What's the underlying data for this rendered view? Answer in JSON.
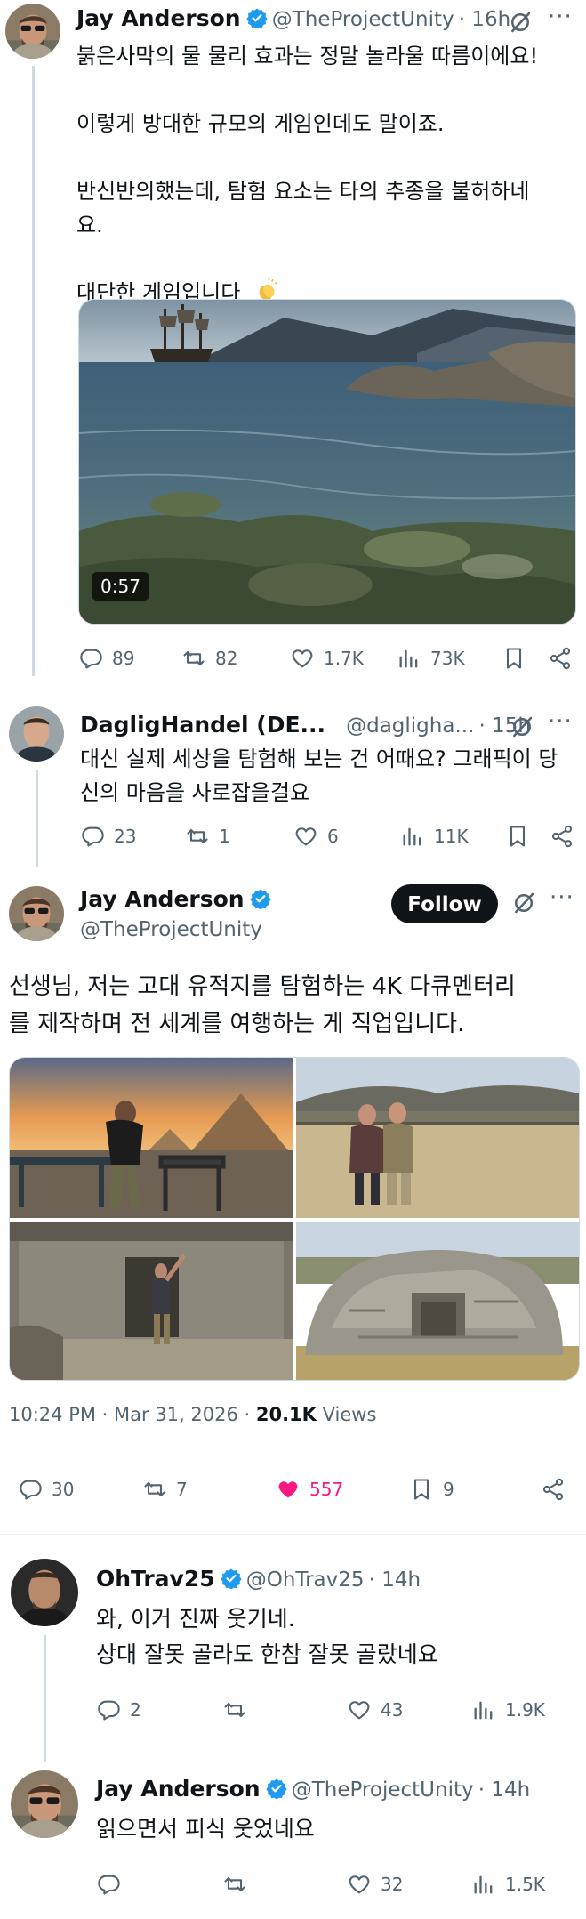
{
  "tweet1": {
    "name": "Jay Anderson",
    "handle": "@TheProjectUnity",
    "time": "· 16h",
    "lines": [
      "붉은사막의 물 물리 효과는 정말 놀라울 따름이에요!",
      "이렇게 방대한 규모의 게임인데도 말이죠.",
      "반신반의했는데, 탐험 요소는 타의 추종을 불허하네",
      "요.",
      "대단한 게임입니다"
    ],
    "emoji": "clapping-hands",
    "video_duration": "0:57",
    "replies": "89",
    "reposts": "82",
    "likes": "1.7K",
    "views": "73K"
  },
  "tweet2": {
    "name": "DagligHandel (DE...",
    "handle": "@daglighа...",
    "time": "· 15h",
    "lines": [
      "대신 실제 세상을 탐험해 보는 건 어때요? 그래픽이 당",
      "신의 마음을 사로잡을걸요"
    ],
    "replies": "23",
    "reposts": "1",
    "likes": "6",
    "views": "11K"
  },
  "main_tweet": {
    "name": "Jay Anderson",
    "handle": "@TheProjectUnity",
    "follow_label": "Follow",
    "lines": [
      "선생님, 저는 고대 유적지를 탐험하는 4K 다큐멘터리",
      "를 제작하며 전 세계를 여행하는 게 직업입니다."
    ],
    "timestamp": "10:24 PM · Mar 31, 2026 · ",
    "views_count": "20.1K",
    "views_label": " Views",
    "replies": "30",
    "reposts": "7",
    "likes": "557",
    "bookmarks": "9",
    "like_color": "#f91880"
  },
  "reply1": {
    "name": "OhTrav25",
    "handle": "@OhTrav25",
    "time": "· 14h",
    "lines": [
      "와, 이거 진짜 웃기네.",
      "상대 잘못 골라도 한참 잘못 골랐네요"
    ],
    "replies": "2",
    "likes": "43",
    "views": "1.9K"
  },
  "reply2": {
    "name": "Jay Anderson",
    "handle": "@TheProjectUnity",
    "time": "· 14h",
    "lines": [
      "읽으면서 피식 웃었네요"
    ],
    "likes": "32",
    "views": "1.5K"
  },
  "colors": {
    "verified_blue": "#1d9bf0",
    "text_muted": "#536471",
    "thread_line": "#cfd9de"
  }
}
